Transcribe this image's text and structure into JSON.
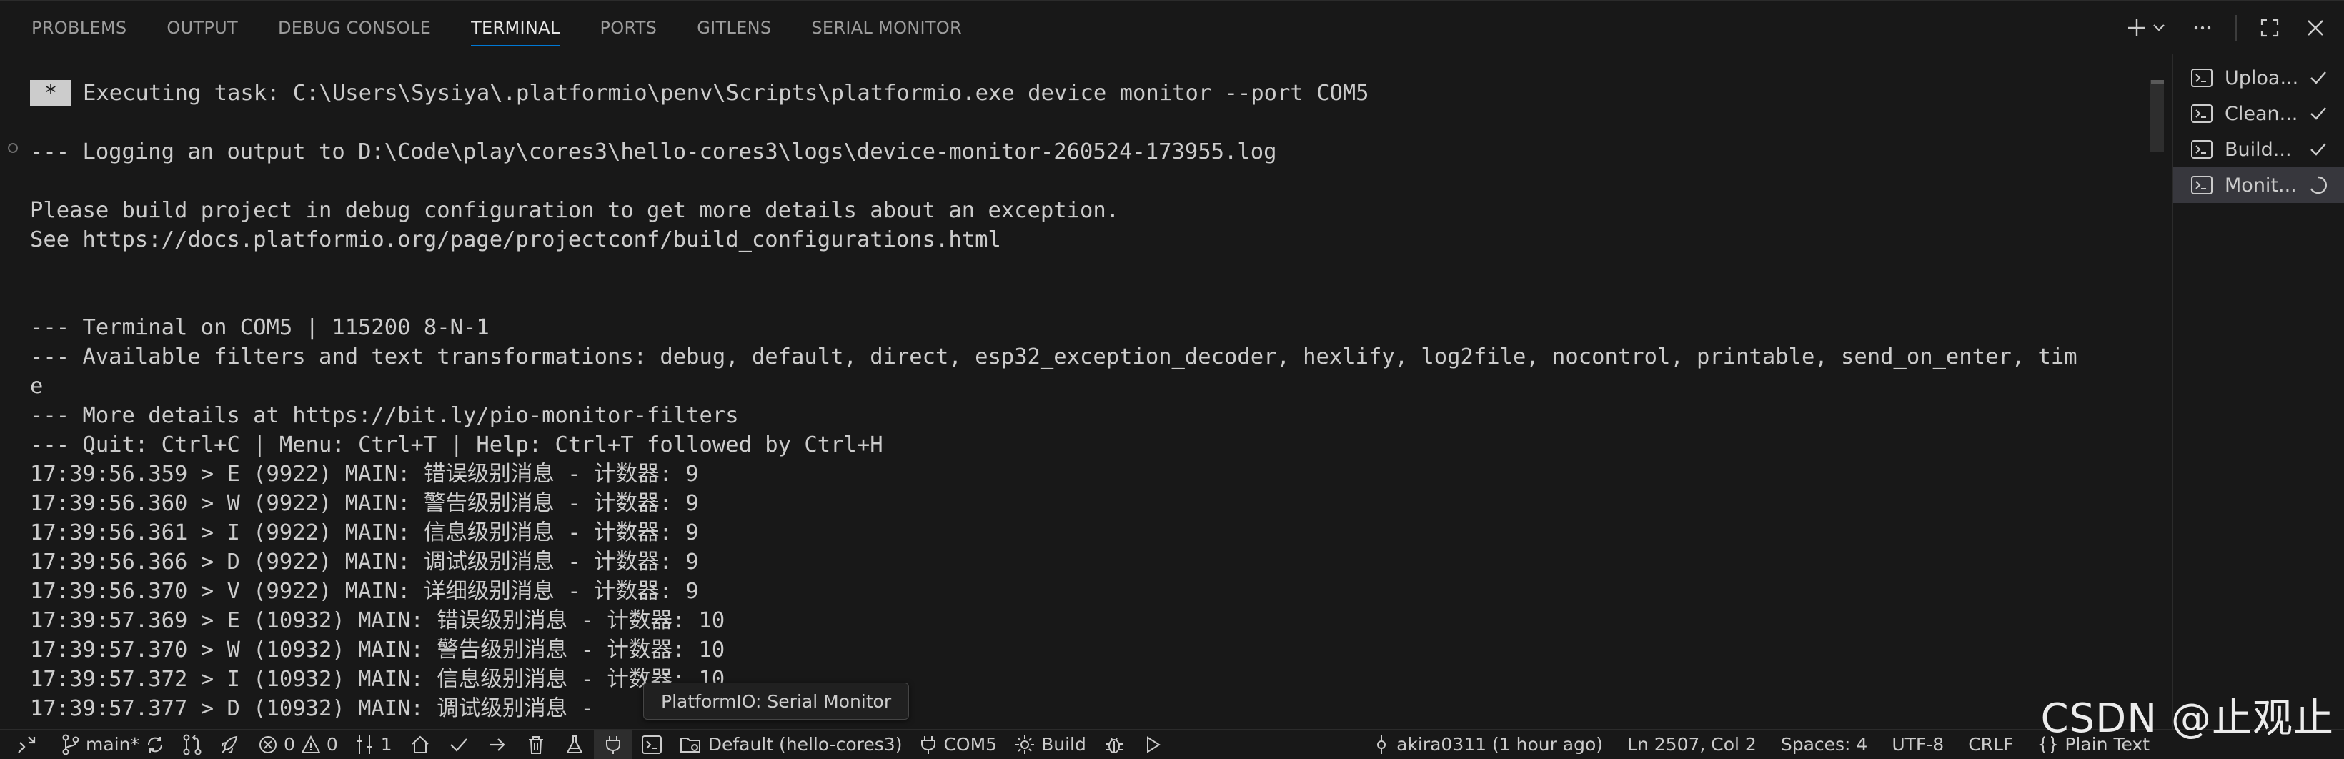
{
  "panel_tabs": [
    {
      "label": "PROBLEMS"
    },
    {
      "label": "OUTPUT"
    },
    {
      "label": "DEBUG CONSOLE"
    },
    {
      "label": "TERMINAL"
    },
    {
      "label": "PORTS"
    },
    {
      "label": "GITLENS"
    },
    {
      "label": "SERIAL MONITOR"
    }
  ],
  "active_tab": "TERMINAL",
  "terminal": {
    "task_marker": "*",
    "lines": [
      "Executing task: C:\\Users\\Sysiya\\.platformio\\penv\\Scripts\\platformio.exe device monitor --port COM5",
      "",
      "--- Logging an output to D:\\Code\\play\\cores3\\hello-cores3\\logs\\device-monitor-260524-173955.log",
      "",
      "Please build project in debug configuration to get more details about an exception.",
      "See https://docs.platformio.org/page/projectconf/build_configurations.html",
      "",
      "",
      "--- Terminal on COM5 | 115200 8-N-1",
      "--- Available filters and text transformations: debug, default, direct, esp32_exception_decoder, hexlify, log2file, nocontrol, printable, send_on_enter, tim",
      "e",
      "--- More details at https://bit.ly/pio-monitor-filters",
      "--- Quit: Ctrl+C | Menu: Ctrl+T | Help: Ctrl+T followed by Ctrl+H",
      "17:39:56.359 > E (9922) MAIN: 错误级别消息 - 计数器: 9",
      "17:39:56.360 > W (9922) MAIN: 警告级别消息 - 计数器: 9",
      "17:39:56.361 > I (9922) MAIN: 信息级别消息 - 计数器: 9",
      "17:39:56.366 > D (9922) MAIN: 调试级别消息 - 计数器: 9",
      "17:39:56.370 > V (9922) MAIN: 详细级别消息 - 计数器: 9",
      "17:39:57.369 > E (10932) MAIN: 错误级别消息 - 计数器: 10",
      "17:39:57.370 > W (10932) MAIN: 警告级别消息 - 计数器: 10",
      "17:39:57.372 > I (10932) MAIN: 信息级别消息 - 计数器: 10",
      "17:39:57.377 > D (10932) MAIN: 调试级别消息 -"
    ]
  },
  "tasks": [
    {
      "name": "Uploa...",
      "state": "done"
    },
    {
      "name": "Clean...",
      "state": "done"
    },
    {
      "name": "Build...",
      "state": "done"
    },
    {
      "name": "Monit...",
      "state": "running"
    }
  ],
  "tooltip": "PlatformIO: Serial Monitor",
  "statusbar": {
    "branch": "main*",
    "errors": "0",
    "warnings": "0",
    "ports": "1",
    "env": "Default (hello-cores3)",
    "port": "COM5",
    "build": "Build",
    "blame": "akira0311 (1 hour ago)",
    "position": "Ln 2507, Col 2",
    "spaces": "Spaces: 4",
    "encoding": "UTF-8",
    "eol": "CRLF",
    "language": "Plain Text"
  },
  "watermark": "CSDN @止观止",
  "colors": {
    "background": "#181818",
    "accent": "#0078d4",
    "text": "#cccccc"
  }
}
